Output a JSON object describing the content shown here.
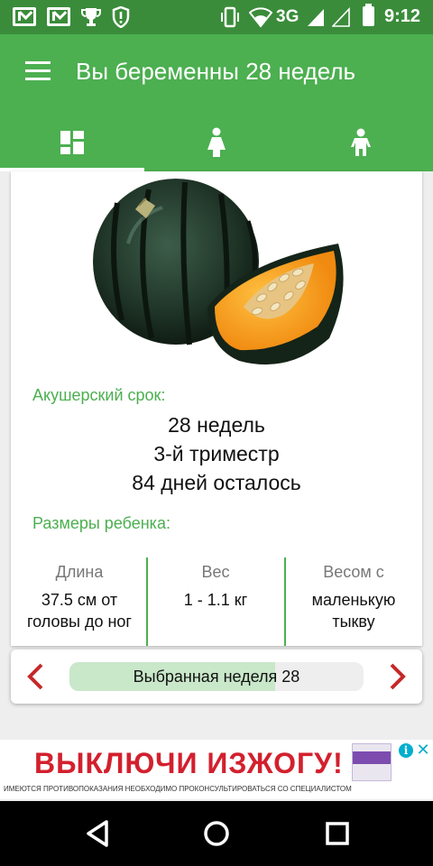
{
  "status_bar": {
    "time": "9:12",
    "network": "3G",
    "icons": [
      "mail-icon",
      "mail-icon",
      "trophy-icon",
      "shield-alert-icon",
      "vibrate-icon",
      "wifi-icon",
      "signal-icon",
      "battery-icon"
    ]
  },
  "app_bar": {
    "title": "Вы беременны 28 недель",
    "tabs": [
      {
        "icon": "dashboard-icon",
        "selected": true
      },
      {
        "icon": "woman-icon",
        "selected": false
      },
      {
        "icon": "child-icon",
        "selected": false
      }
    ]
  },
  "pregnancy": {
    "illustration": "acorn-squash-image",
    "term_label": "Акушерский срок:",
    "weeks": "28 недель",
    "trimester": "3-й триместр",
    "days_left": "84 дней осталось",
    "size_label": "Размеры ребенка:",
    "sizes": [
      {
        "heading": "Длина",
        "value": "37.5 см от головы до ног"
      },
      {
        "heading": "Вес",
        "value": "1 - 1.1 кг"
      },
      {
        "heading": "Весом с",
        "value": "маленькую тыкву"
      }
    ]
  },
  "week_selector": {
    "label": "Выбранная неделя 28",
    "progress_percent": 70,
    "prev_icon": "chevron-left-icon",
    "next_icon": "chevron-right-icon"
  },
  "ad": {
    "headline": "ВЫКЛЮЧИ ИЗЖОГУ!",
    "disclaimer": "ИМЕЮТСЯ ПРОТИВОПОКАЗАНИЯ НЕОБХОДИМО ПРОКОНСУЛЬТИРОВАТЬСЯ СО СПЕЦИАЛИСТОМ",
    "info_icon": "info-icon",
    "close_icon": "close-icon"
  },
  "colors": {
    "status_bar": "#3a8c3a",
    "app_bar": "#4caf50",
    "accent": "#4caf50",
    "arrow": "#c62828",
    "ad_headline": "#d3202e"
  }
}
